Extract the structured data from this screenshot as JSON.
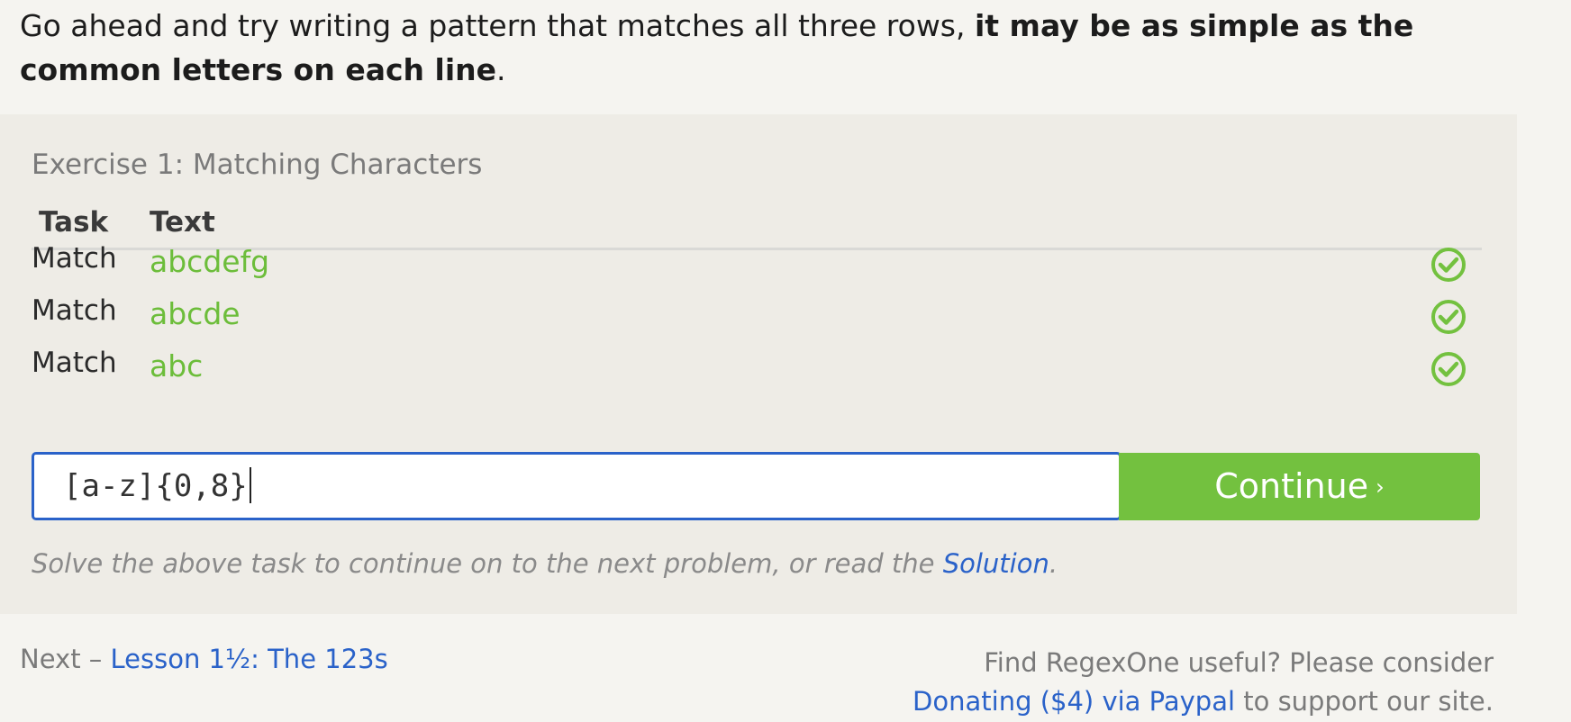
{
  "intro": {
    "text_plain": "Go ahead and try writing a pattern that matches all three rows, ",
    "text_bold": "it may be as simple as the common letters on each line",
    "text_end": "."
  },
  "exercise": {
    "title": "Exercise 1: Matching Characters",
    "headers": {
      "task": "Task",
      "text": "Text"
    },
    "rows": [
      {
        "task": "Match",
        "text": "abcdefg",
        "status": "check-circle-icon"
      },
      {
        "task": "Match",
        "text": "abcde",
        "status": "check-circle-icon"
      },
      {
        "task": "Match",
        "text": "abc",
        "status": "check-circle-icon"
      }
    ],
    "input_value": "[a-z]{0,8}",
    "continue_label": "Continue",
    "continue_chevron": "›",
    "hint_before": "Solve the above task to continue on to the next problem, or read the ",
    "hint_link": "Solution",
    "hint_after": "."
  },
  "footer": {
    "next_label": "Next – ",
    "next_link": "Lesson 1½: The 123s",
    "promo_line1": "Find RegexOne useful? Please consider",
    "promo_link": "Donating ($4) via Paypal",
    "promo_after": " to support our site."
  },
  "colors": {
    "accent_green": "#73c13f",
    "match_text_green": "#6cbd3a",
    "link_blue": "#2a62c9",
    "panel_bg": "#eeece6",
    "page_bg": "#f5f4f0"
  }
}
